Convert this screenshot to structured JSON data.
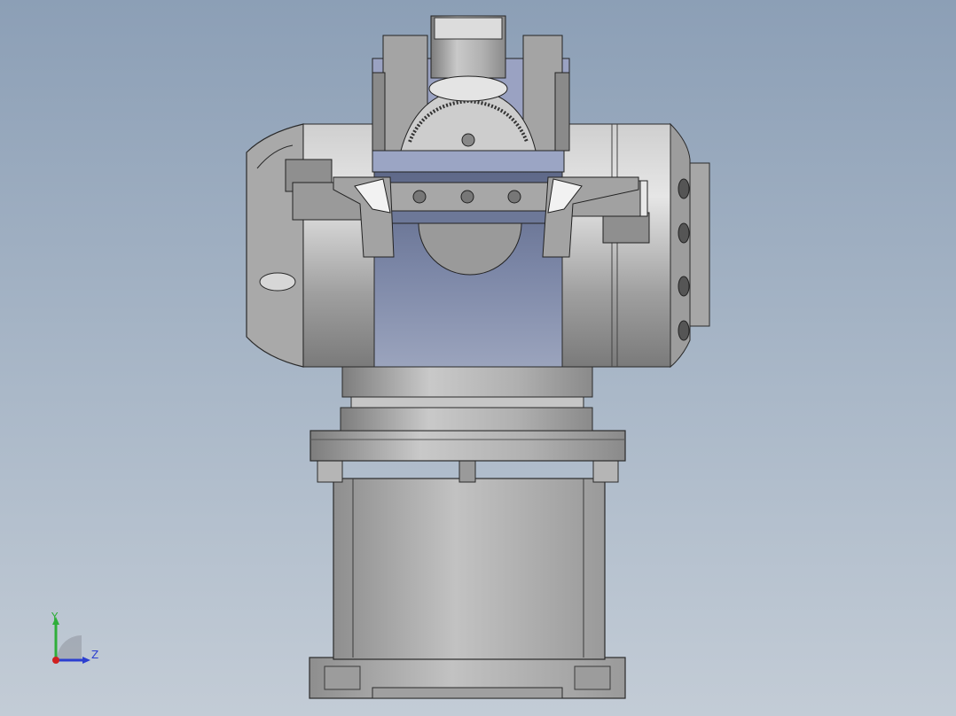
{
  "viewport": {
    "background_top": "#8c9fb6",
    "background_bottom": "#c3ccd6"
  },
  "model": {
    "description_icon": "robot-joint-assembly-icon",
    "metal_color": "#a8a8a8",
    "accent_blue": "#6e7a9a"
  },
  "triad": {
    "y_label": "Y",
    "z_label": "Z",
    "y_color": "#2fae3a",
    "z_color": "#2c3fd0",
    "x_color": "#d02020"
  }
}
